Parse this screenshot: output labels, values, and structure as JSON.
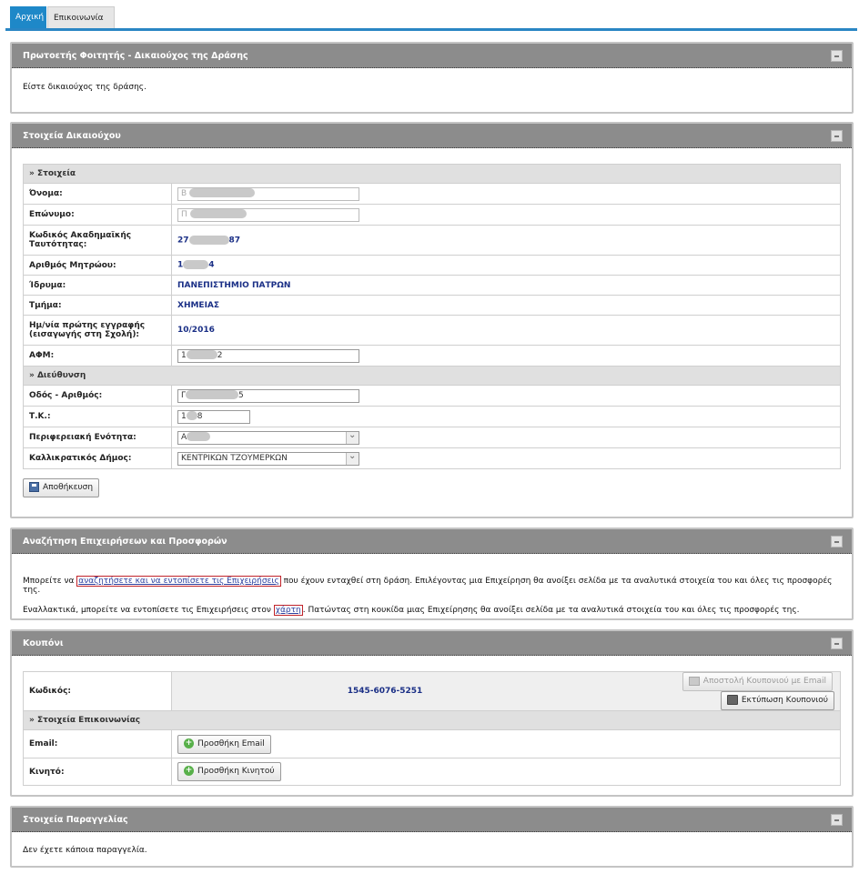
{
  "tabs": {
    "home": "Αρχική",
    "contact": "Επικοινωνία"
  },
  "panel_status": {
    "title": "Πρωτοετής Φοιτητής - Δικαιούχος της Δράσης",
    "message": "Είστε δικαιούχος της δράσης."
  },
  "panel_beneficiary": {
    "title": "Στοιχεία Δικαιούχου",
    "section_details": "» Στοιχεία",
    "rows": {
      "first_name": {
        "label": "Όνομα:",
        "value": "Β"
      },
      "last_name": {
        "label": "Επώνυμο:",
        "value": "Π"
      },
      "academic_id": {
        "label": "Κωδικός Ακαδημαϊκής Ταυτότητας:",
        "prefix": "27",
        "suffix": "87"
      },
      "registry": {
        "label": "Αριθμός Μητρώου:",
        "prefix": "1",
        "suffix": "4"
      },
      "institution": {
        "label": "Ίδρυμα:",
        "value": "ΠΑΝΕΠΙΣΤΗΜΙΟ ΠΑΤΡΩΝ"
      },
      "department": {
        "label": "Τμήμα:",
        "value": "ΧΗΜΕΙΑΣ"
      },
      "first_enrollment": {
        "label": "Ημ/νία πρώτης εγγραφής (εισαγωγής στη Σχολή):",
        "value": "10/2016"
      },
      "afm": {
        "label": "ΑΦΜ:",
        "prefix": "1",
        "suffix": "2"
      }
    },
    "section_address": "» Διεύθυνση",
    "address": {
      "street": {
        "label": "Οδός - Αριθμός:",
        "prefix": "Γ",
        "suffix": "5"
      },
      "postcode": {
        "label": "Τ.Κ.:",
        "prefix": "1",
        "suffix": "8"
      },
      "region": {
        "label": "Περιφερειακή Ενότητα:",
        "prefix": "Α"
      },
      "municipality": {
        "label": "Καλλικρατικός Δήμος:",
        "value": "ΚΕΝΤΡΙΚΩΝ ΤΖΟΥΜΕΡΚΩΝ"
      }
    },
    "save_label": "Αποθήκευση"
  },
  "panel_search": {
    "title": "Αναζήτηση Επιχειρήσεων και Προσφορών",
    "line1_before": "Μπορείτε να ",
    "line1_link": "αναζητήσετε και να εντοπίσετε τις Επιχειρήσεις",
    "line1_after": " που έχουν ενταχθεί στη δράση. Επιλέγοντας μια Επιχείρηση θα ανοίξει σελίδα με τα αναλυτικά στοιχεία του και όλες τις προσφορές της.",
    "line2_before": "Εναλλακτικά, μπορείτε να εντοπίσετε τις Επιχειρήσεις στον ",
    "line2_link": "χάρτη",
    "line2_after": ". Πατώντας στη κουκίδα μιας Επιχείρησης θα ανοίξει σελίδα με τα αναλυτικά στοιχεία του και όλες τις προσφορές της."
  },
  "panel_coupon": {
    "title": "Κουπόνι",
    "code_label": "Κωδικός:",
    "code_value": "1545-6076-5251",
    "send_email_label": "Αποστολή Κουπονιού με Email",
    "print_label": "Εκτύπωση Κουπονιού",
    "section_contact": "» Στοιχεία Επικοινωνίας",
    "email_label": "Email:",
    "add_email_label": "Προσθήκη Email",
    "mobile_label": "Κινητό:",
    "add_mobile_label": "Προσθήκη Κινητού"
  },
  "panel_orders": {
    "title": "Στοιχεία Παραγγελίας",
    "message": "Δεν έχετε κάποια παραγγελία."
  }
}
